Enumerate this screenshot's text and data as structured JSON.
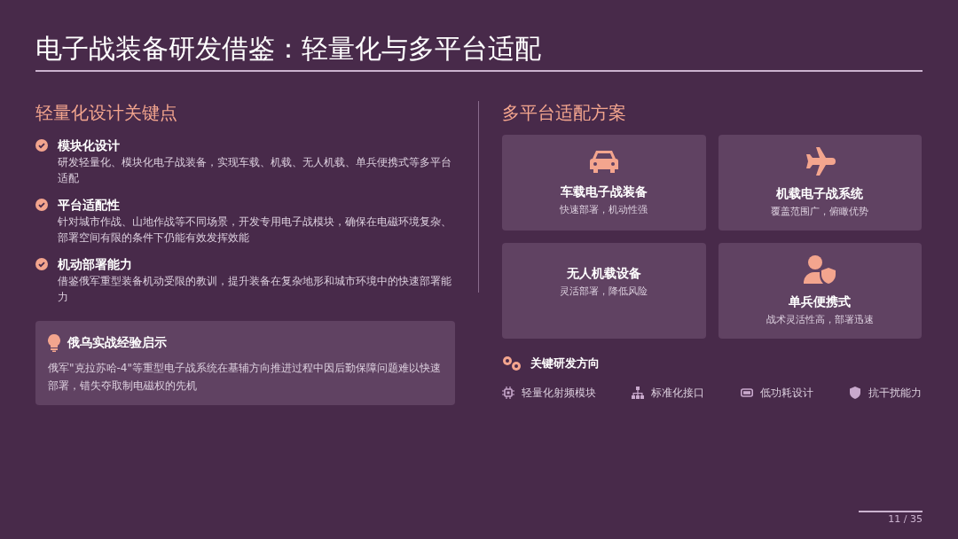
{
  "title": "电子战装备研发借鉴：轻量化与多平台适配",
  "left": {
    "heading": "轻量化设计关键点",
    "points": [
      {
        "title": "模块化设计",
        "text": "研发轻量化、模块化电子战装备，实现车载、机载、无人机载、单兵便携式等多平台适配"
      },
      {
        "title": "平台适配性",
        "text": "针对城市作战、山地作战等不同场景，开发专用电子战模块，确保在电磁环境复杂、部署空间有限的条件下仍能有效发挥效能"
      },
      {
        "title": "机动部署能力",
        "text": "借鉴俄军重型装备机动受限的教训，提升装备在复杂地形和城市环境中的快速部署能力"
      }
    ],
    "callout": {
      "title": "俄乌实战经验启示",
      "text": "俄军\"克拉苏哈-4\"等重型电子战系统在基辅方向推进过程中因后勤保障问题难以快速部署，错失夺取制电磁权的先机"
    }
  },
  "right": {
    "heading": "多平台适配方案",
    "cards": [
      {
        "title": "车载电子战装备",
        "subtitle": "快速部署，机动性强"
      },
      {
        "title": "机载电子战系统",
        "subtitle": "覆盖范围广，俯瞰优势"
      },
      {
        "title": "无人机载设备",
        "subtitle": "灵活部署，降低风险"
      },
      {
        "title": "单兵便携式",
        "subtitle": "战术灵活性高，部署迅速"
      }
    ],
    "directions": {
      "title": "关键研发方向",
      "items": [
        "轻量化射频模块",
        "标准化接口",
        "低功耗设计",
        "抗干扰能力"
      ]
    }
  },
  "page_number": "11 / 35"
}
